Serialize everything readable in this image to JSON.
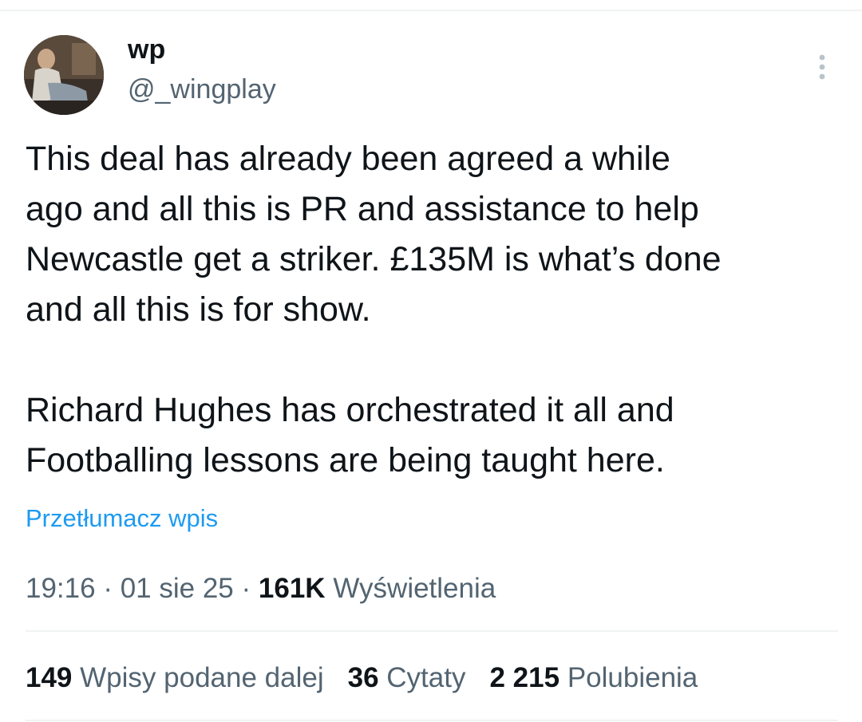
{
  "author": {
    "display_name": "wp",
    "handle": "@_wingplay"
  },
  "tweet": {
    "paragraph_1": "This deal has already been agreed a while\nago and all this is PR and assistance to help\nNewcastle get a striker. £135M is what’s done\nand all this is for show.",
    "paragraph_2": "Richard Hughes has orchestrated it all and\nFootballing lessons are being taught here.",
    "translate_label": "Przetłumacz wpis"
  },
  "meta": {
    "time": "19:16",
    "separator": "·",
    "date": "01 sie 25",
    "views_count": "161K",
    "views_label": "Wyświetlenia"
  },
  "stats": {
    "reposts_count": "149",
    "reposts_label": "Wpisy podane dalej",
    "quotes_count": "36",
    "quotes_label": "Cytaty",
    "likes_count": "2 215",
    "likes_label": "Polubienia"
  },
  "icons": {
    "more": "more-vertical-icon"
  },
  "colors": {
    "text_primary": "#0f1419",
    "text_secondary": "#536471",
    "link": "#1d9bf0",
    "divider": "#eff3f4"
  }
}
